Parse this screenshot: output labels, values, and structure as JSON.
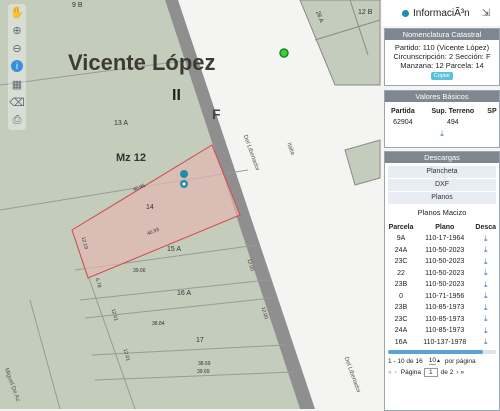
{
  "map": {
    "locality": "Vicente López",
    "section_numeral": "II",
    "letter": "F",
    "block_label": "Mz 12",
    "parcels": [
      "13 A",
      "14",
      "15 A",
      "16 A",
      "17"
    ],
    "dimensions": [
      "40.96",
      "40.93",
      "12.19",
      "39.66",
      "38.84",
      "38.69",
      "39.69",
      "12.00",
      "12.00",
      "6.78",
      "12.01",
      "12.01"
    ],
    "top_labels": [
      "9 B",
      "12 B",
      "26 A"
    ],
    "streets": [
      "Italia",
      "Del Libertador",
      "Del Libertador",
      "Miguel De Az"
    ]
  },
  "toolbar": {
    "icons": [
      "hand-icon",
      "zoom-in-icon",
      "zoom-out-icon",
      "info-icon",
      "measure-icon",
      "clear-icon",
      "print-icon"
    ]
  },
  "panel": {
    "title": "InformaciÃ³n",
    "nomenclatura": {
      "heading": "Nomenclatura Catastral",
      "line1": "Partido: 110 (Vicente López)",
      "line2": "Circunscripción: 2 Sección: F",
      "line3": "Manzana: 12 Parcela: 14",
      "copy": "Copiar"
    },
    "valores": {
      "heading": "Valores Básicos",
      "headers": [
        "Partida",
        "Sup. Terreno",
        "SP"
      ],
      "row": [
        "62904",
        "494",
        ""
      ]
    },
    "descargas": {
      "heading": "Descargas",
      "items": [
        "Plancheta",
        "DXF",
        "Planos"
      ],
      "subheading": "Planos Macizo",
      "columns": [
        "Parcela",
        "Plano",
        "Desca"
      ],
      "rows": [
        {
          "parcela": "9A",
          "plano": "110-17-1964"
        },
        {
          "parcela": "24A",
          "plano": "110-50-2023"
        },
        {
          "parcela": "23C",
          "plano": "110-50-2023"
        },
        {
          "parcela": "22",
          "plano": "110-50-2023"
        },
        {
          "parcela": "23B",
          "plano": "110-50-2023"
        },
        {
          "parcela": "0",
          "plano": "110-71-1956"
        },
        {
          "parcela": "23B",
          "plano": "110-85-1973"
        },
        {
          "parcela": "23C",
          "plano": "110-85-1973"
        },
        {
          "parcela": "24A",
          "plano": "110-85-1973"
        },
        {
          "parcela": "16A",
          "plano": "110-137-1978"
        }
      ],
      "summary": "1 - 10 de 16",
      "page_size": "10",
      "per_page": "por página",
      "page_label": "Página",
      "page_value": "1",
      "of_label": "de 2"
    }
  }
}
